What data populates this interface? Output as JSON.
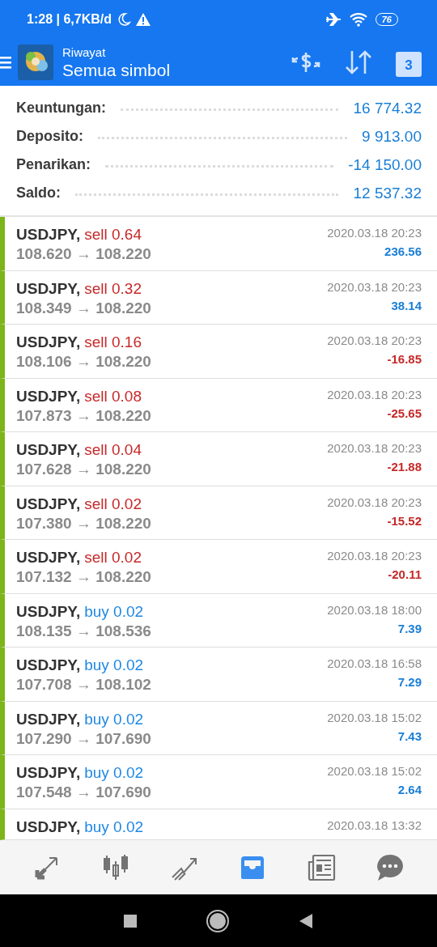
{
  "status_bar": {
    "time": "1:28 | 6,7KB/d",
    "battery": "76"
  },
  "header": {
    "subtitle": "Riwayat",
    "title": "Semua simbol",
    "calendar_day": "3"
  },
  "summary": [
    {
      "label": "Keuntungan:",
      "value": "16 774.32"
    },
    {
      "label": "Deposito:",
      "value": "9 913.00"
    },
    {
      "label": "Penarikan:",
      "value": "-14 150.00"
    },
    {
      "label": "Saldo:",
      "value": "12 537.32"
    }
  ],
  "trades": [
    {
      "symbol": "USDJPY,",
      "side": "sell",
      "volume": "0.64",
      "prices": "108.620 → 108.220",
      "time": "2020.03.18 20:23",
      "profit": "236.56",
      "color": "#1a7ed6"
    },
    {
      "symbol": "USDJPY,",
      "side": "sell",
      "volume": "0.32",
      "prices": "108.349 → 108.220",
      "time": "2020.03.18 20:23",
      "profit": "38.14",
      "color": "#1a7ed6"
    },
    {
      "symbol": "USDJPY,",
      "side": "sell",
      "volume": "0.16",
      "prices": "108.106 → 108.220",
      "time": "2020.03.18 20:23",
      "profit": "-16.85",
      "color": "#c62828"
    },
    {
      "symbol": "USDJPY,",
      "side": "sell",
      "volume": "0.08",
      "prices": "107.873 → 108.220",
      "time": "2020.03.18 20:23",
      "profit": "-25.65",
      "color": "#c62828"
    },
    {
      "symbol": "USDJPY,",
      "side": "sell",
      "volume": "0.04",
      "prices": "107.628 → 108.220",
      "time": "2020.03.18 20:23",
      "profit": "-21.88",
      "color": "#c62828"
    },
    {
      "symbol": "USDJPY,",
      "side": "sell",
      "volume": "0.02",
      "prices": "107.380 → 108.220",
      "time": "2020.03.18 20:23",
      "profit": "-15.52",
      "color": "#c62828"
    },
    {
      "symbol": "USDJPY,",
      "side": "sell",
      "volume": "0.02",
      "prices": "107.132 → 108.220",
      "time": "2020.03.18 20:23",
      "profit": "-20.11",
      "color": "#c62828"
    },
    {
      "symbol": "USDJPY,",
      "side": "buy",
      "volume": "0.02",
      "prices": "108.135 → 108.536",
      "time": "2020.03.18 18:00",
      "profit": "7.39",
      "color": "#1a7ed6"
    },
    {
      "symbol": "USDJPY,",
      "side": "buy",
      "volume": "0.02",
      "prices": "107.708 → 108.102",
      "time": "2020.03.18 16:58",
      "profit": "7.29",
      "color": "#1a7ed6"
    },
    {
      "symbol": "USDJPY,",
      "side": "buy",
      "volume": "0.02",
      "prices": "107.290 → 107.690",
      "time": "2020.03.18 15:02",
      "profit": "7.43",
      "color": "#1a7ed6"
    },
    {
      "symbol": "USDJPY,",
      "side": "buy",
      "volume": "0.02",
      "prices": "107.548 → 107.690",
      "time": "2020.03.18 15:02",
      "profit": "2.64",
      "color": "#1a7ed6"
    },
    {
      "symbol": "USDJPY,",
      "side": "buy",
      "volume": "0.02",
      "time": "2020.03.18 13:32"
    }
  ],
  "bottom_nav": [
    {
      "kind": "quotes",
      "selected": false
    },
    {
      "kind": "chart",
      "selected": false
    },
    {
      "kind": "trade",
      "selected": false
    },
    {
      "kind": "history",
      "selected": true
    },
    {
      "kind": "news",
      "selected": false
    },
    {
      "kind": "chat",
      "selected": false
    }
  ]
}
